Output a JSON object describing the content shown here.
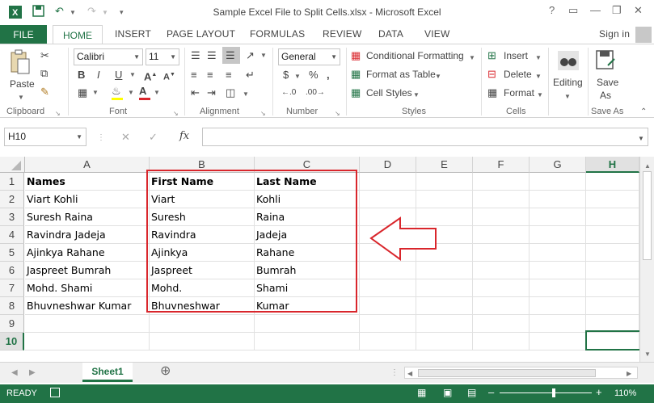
{
  "title": "Sample Excel File to Split Cells.xlsx - Microsoft Excel",
  "signin": "Sign in",
  "tabs": {
    "file": "FILE",
    "home": "HOME",
    "insert": "INSERT",
    "page_layout": "PAGE LAYOUT",
    "formulas": "FORMULAS",
    "review": "REVIEW",
    "data": "DATA",
    "view": "VIEW"
  },
  "ribbon": {
    "clipboard": {
      "paste": "Paste",
      "label": "Clipboard"
    },
    "font": {
      "name": "Calibri",
      "size": "11",
      "label": "Font"
    },
    "alignment": {
      "label": "Alignment"
    },
    "number": {
      "format": "General",
      "label": "Number"
    },
    "styles": {
      "conditional": "Conditional Formatting",
      "format_table": "Format as Table",
      "cell_styles": "Cell Styles",
      "label": "Styles"
    },
    "cells": {
      "insert": "Insert",
      "delete": "Delete",
      "format": "Format",
      "label": "Cells"
    },
    "editing": {
      "label": "Editing"
    },
    "saveas": {
      "line1": "Save",
      "line2": "As",
      "label": "Save As"
    }
  },
  "namebox": "H10",
  "fx": "fx",
  "columns": [
    "A",
    "B",
    "C",
    "D",
    "E",
    "F",
    "G",
    "H"
  ],
  "rows": [
    "1",
    "2",
    "3",
    "4",
    "5",
    "6",
    "7",
    "8",
    "9",
    "10"
  ],
  "cells": {
    "A": [
      "Names",
      "Viart Kohli",
      "Suresh Raina",
      "Ravindra Jadeja",
      "Ajinkya Rahane",
      "Jaspreet Bumrah",
      "Mohd. Shami",
      "Bhuvneshwar Kumar",
      "",
      ""
    ],
    "B": [
      "First Name",
      "Viart",
      "Suresh",
      "Ravindra",
      "Ajinkya",
      "Jaspreet",
      "Mohd.",
      "Bhuvneshwar",
      "",
      ""
    ],
    "C": [
      "Last Name",
      "Kohli",
      "Raina",
      "Jadeja",
      "Rahane",
      "Bumrah",
      "Shami",
      "Kumar",
      "",
      ""
    ]
  },
  "sheet_tab": "Sheet1",
  "status": {
    "ready": "READY",
    "zoom": "110%"
  },
  "colors": {
    "excel_green": "#217346",
    "highlight_red": "#d9262c"
  }
}
